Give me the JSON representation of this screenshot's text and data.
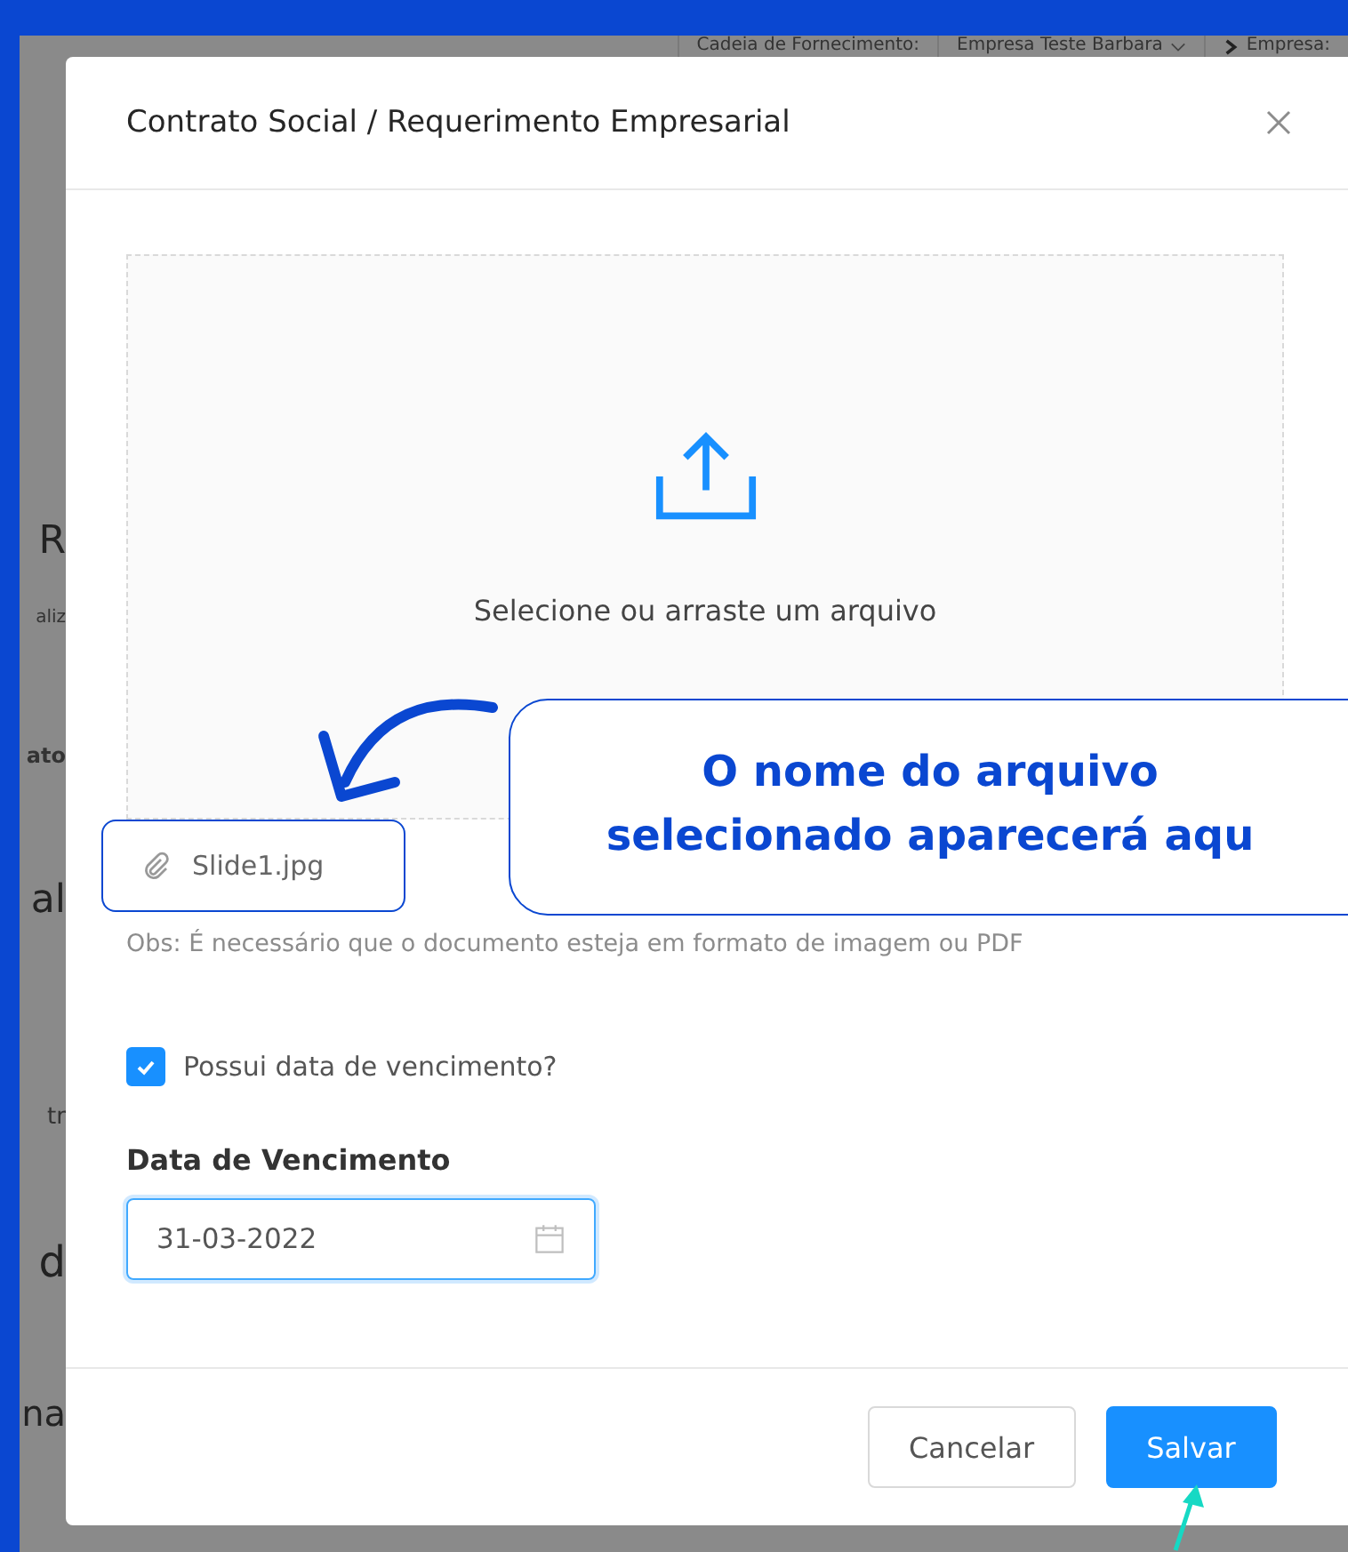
{
  "background": {
    "header_items": [
      {
        "label": "Cadeia de Fornecimento:",
        "kind": "text"
      },
      {
        "label": "Empresa Teste Barbara",
        "kind": "dropdown"
      },
      {
        "label": "Empresa:",
        "kind": "link"
      }
    ],
    "side_fragments": [
      "R",
      "aliz",
      "ato",
      "al",
      "tr",
      "d",
      "na"
    ]
  },
  "dialog": {
    "title": "Contrato Social / Requerimento Empresarial",
    "upload": {
      "prompt": "Selecione ou arraste um arquivo"
    },
    "file": {
      "name": "Slide1.jpg"
    },
    "note": "Obs: É necessário que o documento esteja em formato de imagem ou PDF",
    "expiry_checkbox": {
      "label": "Possui data de vencimento?",
      "checked": true
    },
    "date_field": {
      "label": "Data de Vencimento",
      "value": "31-03-2022"
    },
    "buttons": [
      {
        "label": "Cancelar",
        "kind": "default"
      },
      {
        "label": "Salvar",
        "kind": "primary"
      }
    ]
  },
  "annotation": {
    "callout_lines": [
      "O nome do arquivo",
      "selecionado aparecerá aqu"
    ]
  }
}
